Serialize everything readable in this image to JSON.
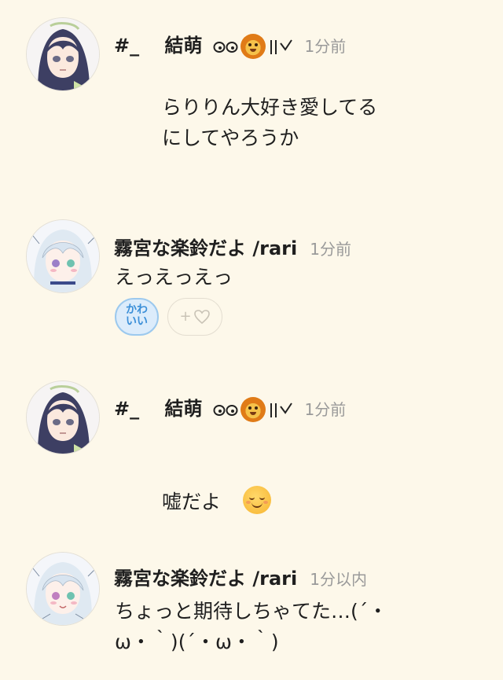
{
  "posts": [
    {
      "name": "#_　 結萌",
      "time": "1分前",
      "message": "らりりん大好き愛してる\nにしてやろうか",
      "decorations": [
        "eyes-glyph",
        "lion-emoji",
        "hand-glyph"
      ]
    },
    {
      "name": "霧宮な楽鈴だよ /rari",
      "time": "1分前",
      "message": "えっえっえっ",
      "reactions": [
        {
          "label": "かわ\nいい",
          "kind": "kawaii-badge"
        },
        {
          "label": "+",
          "kind": "add-reaction"
        }
      ]
    },
    {
      "name": "#_　 結萌",
      "time": "1分前",
      "message": "嘘だよ",
      "emoji": "relieved-smiling-face",
      "decorations": [
        "eyes-glyph",
        "lion-emoji",
        "hand-glyph"
      ]
    },
    {
      "name": "霧宮な楽鈴だよ /rari",
      "time": "1分以内",
      "message": "ちょっと期待しちゃてた…(´・\nω・｀)(´・ω・｀)"
    }
  ]
}
